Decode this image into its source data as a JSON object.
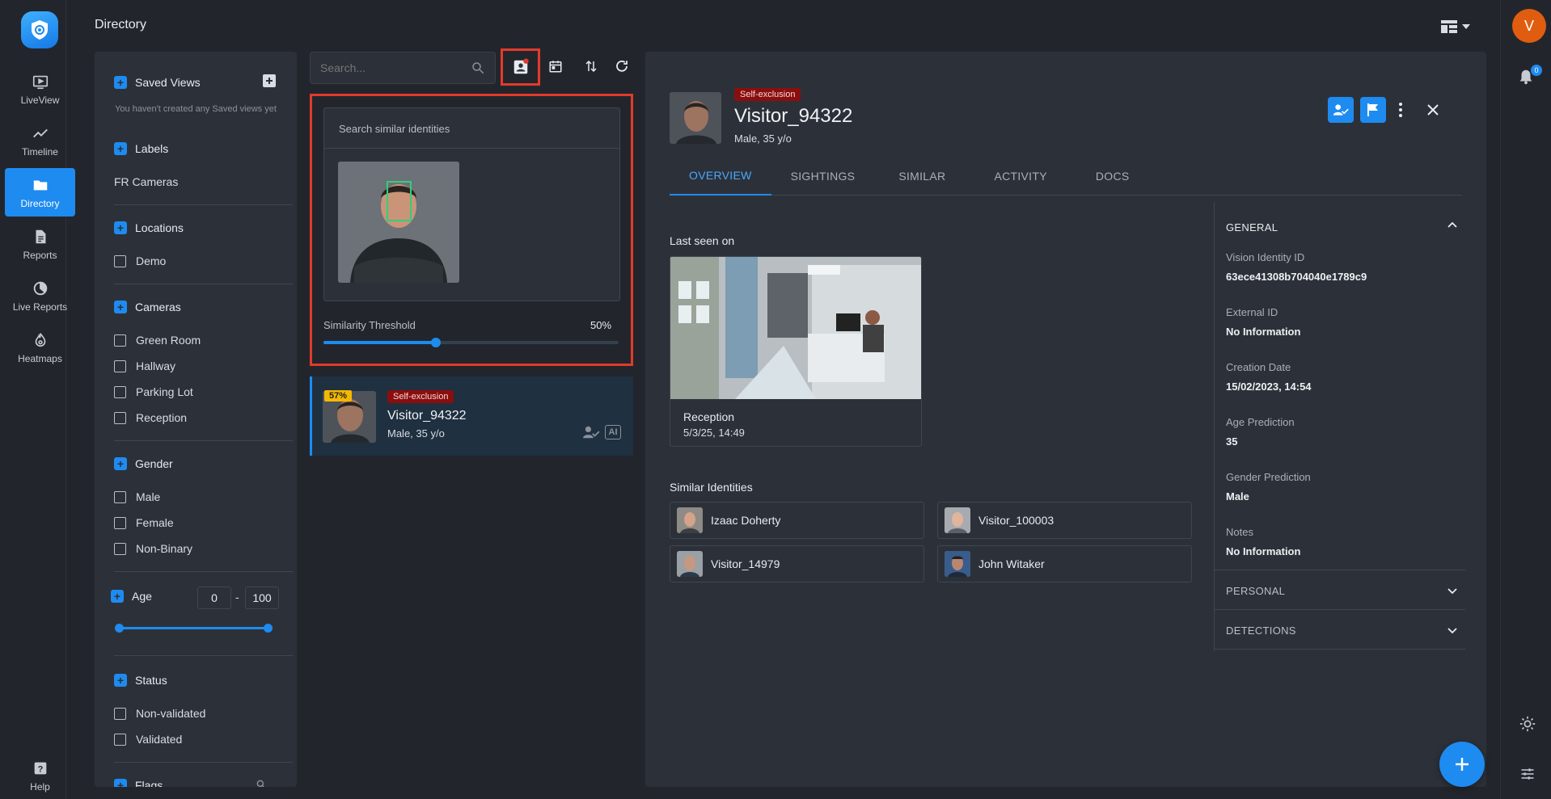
{
  "app": {
    "page_title": "Directory",
    "user_initial": "V",
    "notification_count": "0"
  },
  "nav": {
    "items": [
      {
        "label": "LiveView",
        "icon": "liveview-icon"
      },
      {
        "label": "Timeline",
        "icon": "timeline-icon"
      },
      {
        "label": "Directory",
        "icon": "folder-icon"
      },
      {
        "label": "Reports",
        "icon": "report-icon"
      },
      {
        "label": "Live Reports",
        "icon": "live-reports-icon"
      },
      {
        "label": "Heatmaps",
        "icon": "heatmap-icon"
      }
    ],
    "help": "Help"
  },
  "filters": {
    "saved_views": {
      "title": "Saved Views",
      "empty": "You haven't created any Saved views yet"
    },
    "labels": {
      "title": "Labels",
      "items": [
        "FR Cameras"
      ]
    },
    "locations": {
      "title": "Locations",
      "items": [
        "Demo"
      ]
    },
    "cameras": {
      "title": "Cameras",
      "items": [
        "Green Room",
        "Hallway",
        "Parking Lot",
        "Reception"
      ]
    },
    "gender": {
      "title": "Gender",
      "items": [
        "Male",
        "Female",
        "Non-Binary"
      ]
    },
    "age": {
      "title": "Age",
      "min": "0",
      "max": "100",
      "separator": "-"
    },
    "status": {
      "title": "Status",
      "items": [
        "Non-validated",
        "Validated"
      ]
    },
    "flags": {
      "title": "Flags"
    }
  },
  "search": {
    "placeholder": "Search..."
  },
  "similar_search": {
    "title": "Search similar identities",
    "threshold_label": "Similarity Threshold",
    "threshold_value": "50%",
    "threshold_fraction": 0.38
  },
  "result": {
    "match_pct": "57%",
    "tag": "Self-exclusion",
    "name": "Visitor_94322",
    "sub": "Male, 35 y/o",
    "ai_label": "AI"
  },
  "detail": {
    "tag": "Self-exclusion",
    "name": "Visitor_94322",
    "sub": "Male, 35 y/o",
    "tabs": [
      "OVERVIEW",
      "SIGHTINGS",
      "SIMILAR",
      "ACTIVITY",
      "DOCS"
    ],
    "last_seen_label": "Last seen on",
    "last_seen_location": "Reception",
    "last_seen_time": "5/3/25, 14:49",
    "similar_label": "Similar Identities",
    "similar": [
      "Izaac Doherty",
      "Visitor_100003",
      "Visitor_14979",
      "John Witaker"
    ],
    "general": {
      "title": "GENERAL",
      "fields": [
        {
          "label": "Vision Identity ID",
          "value": "63ece41308b704040e1789c9"
        },
        {
          "label": "External ID",
          "value": "No Information"
        },
        {
          "label": "Creation Date",
          "value": "15/02/2023, 14:54"
        },
        {
          "label": "Age Prediction",
          "value": "35"
        },
        {
          "label": "Gender Prediction",
          "value": "Male"
        },
        {
          "label": "Notes",
          "value": "No Information"
        }
      ],
      "personal": "PERSONAL",
      "detections": "DETECTIONS"
    }
  },
  "colors": {
    "accent": "#1e8bf0",
    "highlight": "#e23a2a",
    "tag": "#8b0e0e",
    "badge": "#f5b800"
  }
}
